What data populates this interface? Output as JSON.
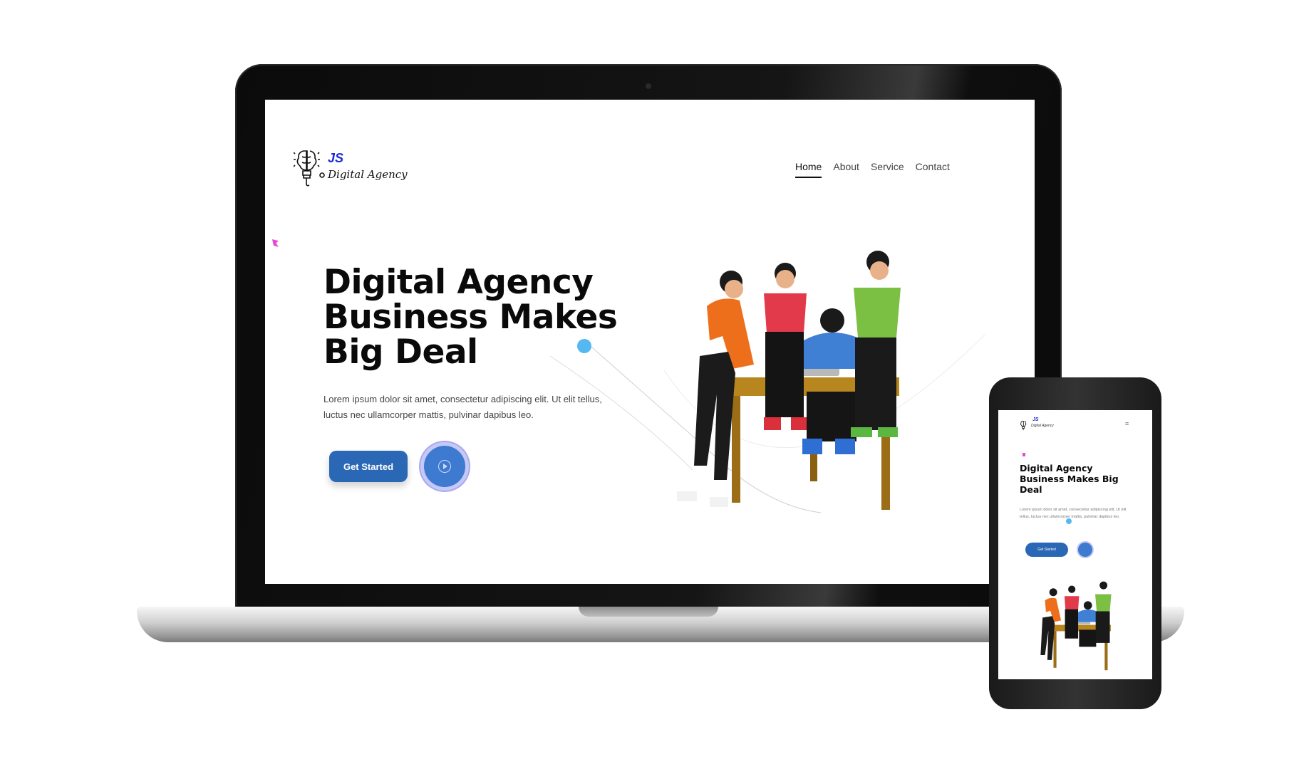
{
  "site": {
    "logo_mark": "JS",
    "logo_name": "Digital Agency",
    "nav": [
      {
        "label": "Home",
        "active": true
      },
      {
        "label": "About",
        "active": false
      },
      {
        "label": "Service",
        "active": false
      },
      {
        "label": "Contact",
        "active": false
      }
    ],
    "hero": {
      "title": "Digital Agency Business Makes Big Deal",
      "text": "Lorem ipsum dolor sit amet, consectetur adipiscing elit. Ut elit tellus, luctus nec ullamcorper mattis, pulvinar dapibus leo.",
      "cta_label": "Get Started"
    }
  },
  "mobile": {
    "menu_icon": "hamburger-icon"
  },
  "colors": {
    "primary": "#2a67b5",
    "logo_blue": "#1a2bd6",
    "accent_dot": "#56b8f2",
    "accent_pink": "#e24bd6"
  }
}
